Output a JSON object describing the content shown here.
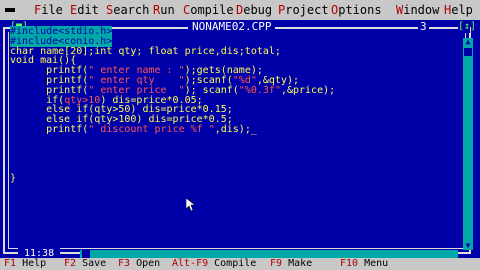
{
  "menu": {
    "items": [
      {
        "hot": "F",
        "rest": "ile"
      },
      {
        "hot": "E",
        "rest": "dit"
      },
      {
        "hot": "S",
        "rest": "earch"
      },
      {
        "hot": "R",
        "rest": "un"
      },
      {
        "hot": "C",
        "rest": "ompile"
      },
      {
        "hot": "D",
        "rest": "ebug"
      },
      {
        "hot": "P",
        "rest": "roject"
      },
      {
        "hot": "O",
        "rest": "ptions"
      },
      {
        "hot": "W",
        "rest": "indow"
      },
      {
        "hot": "H",
        "rest": "elp"
      }
    ]
  },
  "window": {
    "close": "[■]",
    "title": "NONAME02.CPP",
    "number": "3",
    "zoom": "[↕]",
    "position": "11:38"
  },
  "code": {
    "lines": [
      [
        {
          "t": "#include<stdio.h>",
          "c": "hl"
        }
      ],
      [
        {
          "t": "#include<conio.h>",
          "c": "hl"
        }
      ],
      [
        {
          "t": "char name[20];int qty; float price,dis;total;"
        }
      ],
      [
        {
          "t": "void mai(){"
        }
      ],
      [
        {
          "t": "      printf("
        },
        {
          "t": "\" enter name : \"",
          "c": "str"
        },
        {
          "t": ");gets(name);"
        }
      ],
      [
        {
          "t": "      printf("
        },
        {
          "t": "\" enter qty    \"",
          "c": "str"
        },
        {
          "t": ");scanf("
        },
        {
          "t": "\"%d\"",
          "c": "str"
        },
        {
          "t": ",&qty);"
        }
      ],
      [
        {
          "t": "      printf("
        },
        {
          "t": "\" enter price  \"",
          "c": "str"
        },
        {
          "t": "); scanf("
        },
        {
          "t": "\"%0.3f\"",
          "c": "str"
        },
        {
          "t": ",&price);"
        }
      ],
      [
        {
          "t": "      if("
        },
        {
          "t": "qty>10",
          "c": "str"
        },
        {
          "t": ") dis=price*0.05;"
        }
      ],
      [
        {
          "t": "      else if(qty>50) dis=price*0.15;"
        }
      ],
      [
        {
          "t": "      else if(qty>100) dis=price*0.5;"
        }
      ],
      [
        {
          "t": "      printf("
        },
        {
          "t": "\" discount price %f \"",
          "c": "str"
        },
        {
          "t": ",dis);"
        },
        {
          "t": "_",
          "c": "cursor"
        }
      ],
      [
        {
          "t": ""
        }
      ],
      [
        {
          "t": ""
        }
      ],
      [
        {
          "t": ""
        }
      ],
      [
        {
          "t": ""
        }
      ],
      [
        {
          "t": "}"
        }
      ]
    ]
  },
  "status": {
    "items": [
      {
        "key": "F1",
        "label": " Help"
      },
      {
        "key": "F2",
        "label": " Save"
      },
      {
        "key": "F3",
        "label": " Open"
      },
      {
        "key": "Alt-F9",
        "label": " Compile"
      },
      {
        "key": "F9",
        "label": " Make"
      },
      {
        "key": "F10",
        "label": " Menu"
      }
    ]
  },
  "colors": {
    "background": "#0000a8",
    "menubar": "#c8c8c8",
    "hotkey": "#b00000",
    "code_text": "#ffff55",
    "string_text": "#ff5555",
    "highlight": "#00a8a8"
  }
}
